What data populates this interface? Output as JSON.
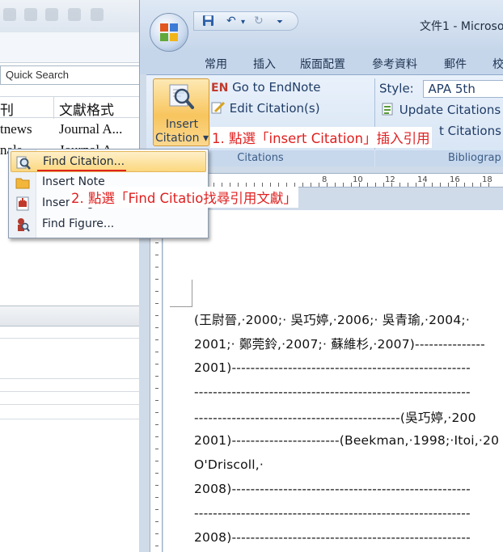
{
  "background_window": {
    "quick_search": "Quick Search",
    "columns": [
      "刊",
      "文獻格式"
    ],
    "rows": [
      [
        "tnews",
        "Journal A..."
      ],
      [
        "nals",
        "Journal A..."
      ]
    ]
  },
  "word": {
    "title": "文件1 - Microso",
    "tabs": [
      "常用",
      "插入",
      "版面配置",
      "參考資料",
      "郵件",
      "校"
    ],
    "ribbon": {
      "insert_citation_line1": "Insert",
      "insert_citation_line2": "Citation ▾",
      "go_to_endnote": "Go to EndNote",
      "en_mark": "EN",
      "edit_citations": "Edit Citation(s)",
      "style_label": "Style:",
      "style_value": "APA 5th",
      "update_citations": "Update Citations a",
      "convert_citations": "t Citations a",
      "group_citations": "Citations",
      "group_bibliography": "Bibliograp"
    },
    "ruler_numbers": [
      "8",
      "10",
      "12",
      "14",
      "16",
      "18"
    ],
    "document_lines": [
      "(王尉晉,·2000;· 吳巧婷,·2006;· 吳青瑜,·2004;·",
      "2001;· 鄭莞鈴,·2007;· 蘇維杉,·2007)---------------",
      "2001)---------------------------------------------------",
      "-----------------------------------------------------------",
      "--------------------------------------------(吳巧婷,·200",
      "2001)-----------------------(Beekman,·1998;·Itoi,·20",
      "O'Driscoll,·",
      "2008)---------------------------------------------------",
      "-----------------------------------------------------------",
      "2008)---------------------------------------------------"
    ]
  },
  "menu": {
    "items": [
      {
        "label": "Find Citation...",
        "icon": "find-citation-icon"
      },
      {
        "label": "Insert Note",
        "icon": "folder-icon"
      },
      {
        "label": "Insert Figure",
        "icon": "insert-figure-icon"
      },
      {
        "label": "Find Figure...",
        "icon": "find-figure-icon"
      }
    ]
  },
  "annotations": {
    "step1": "1. 點選「insert Citation」插入引用",
    "step2": "2. 點選「Find Citatio找尋引用文獻」"
  },
  "colors": {
    "annotation_red": "#e02020",
    "ribbon_blue": "#d5e3f3",
    "highlight_orange": "#fbd77e"
  }
}
